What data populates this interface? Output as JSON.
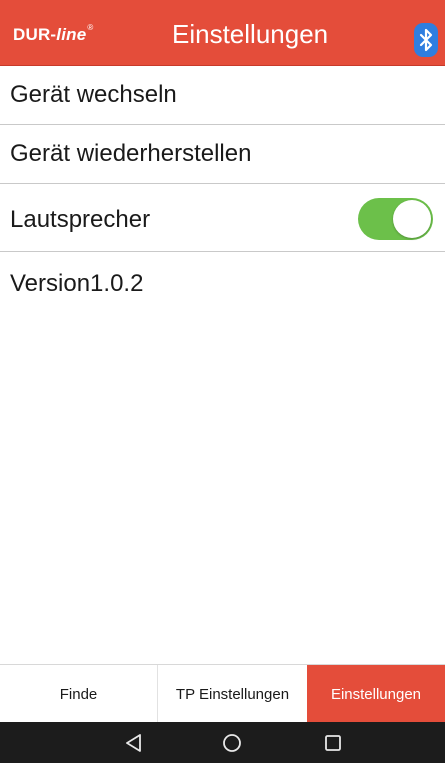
{
  "header": {
    "logo_main": "DUR-",
    "logo_italic": "line",
    "logo_mark": "®",
    "title": "Einstellungen",
    "bluetooth_icon": "bluetooth-icon",
    "accent_color": "#e44d3a",
    "bluetooth_color": "#2f7ee0"
  },
  "settings": {
    "change_device": "Gerät wechseln",
    "restore_device": "Gerät wiederherstellen",
    "speaker": "Lautsprecher",
    "speaker_enabled": true,
    "toggle_color": "#6cc04a",
    "version": "Version1.0.2"
  },
  "tabs": [
    {
      "label": "Finde",
      "active": false
    },
    {
      "label": "TP Einstellungen",
      "active": false
    },
    {
      "label": "Einstellungen",
      "active": true
    }
  ],
  "navbar": {
    "back_icon": "back-triangle-icon",
    "home_icon": "home-circle-icon",
    "recent_icon": "recent-apps-square-icon"
  }
}
